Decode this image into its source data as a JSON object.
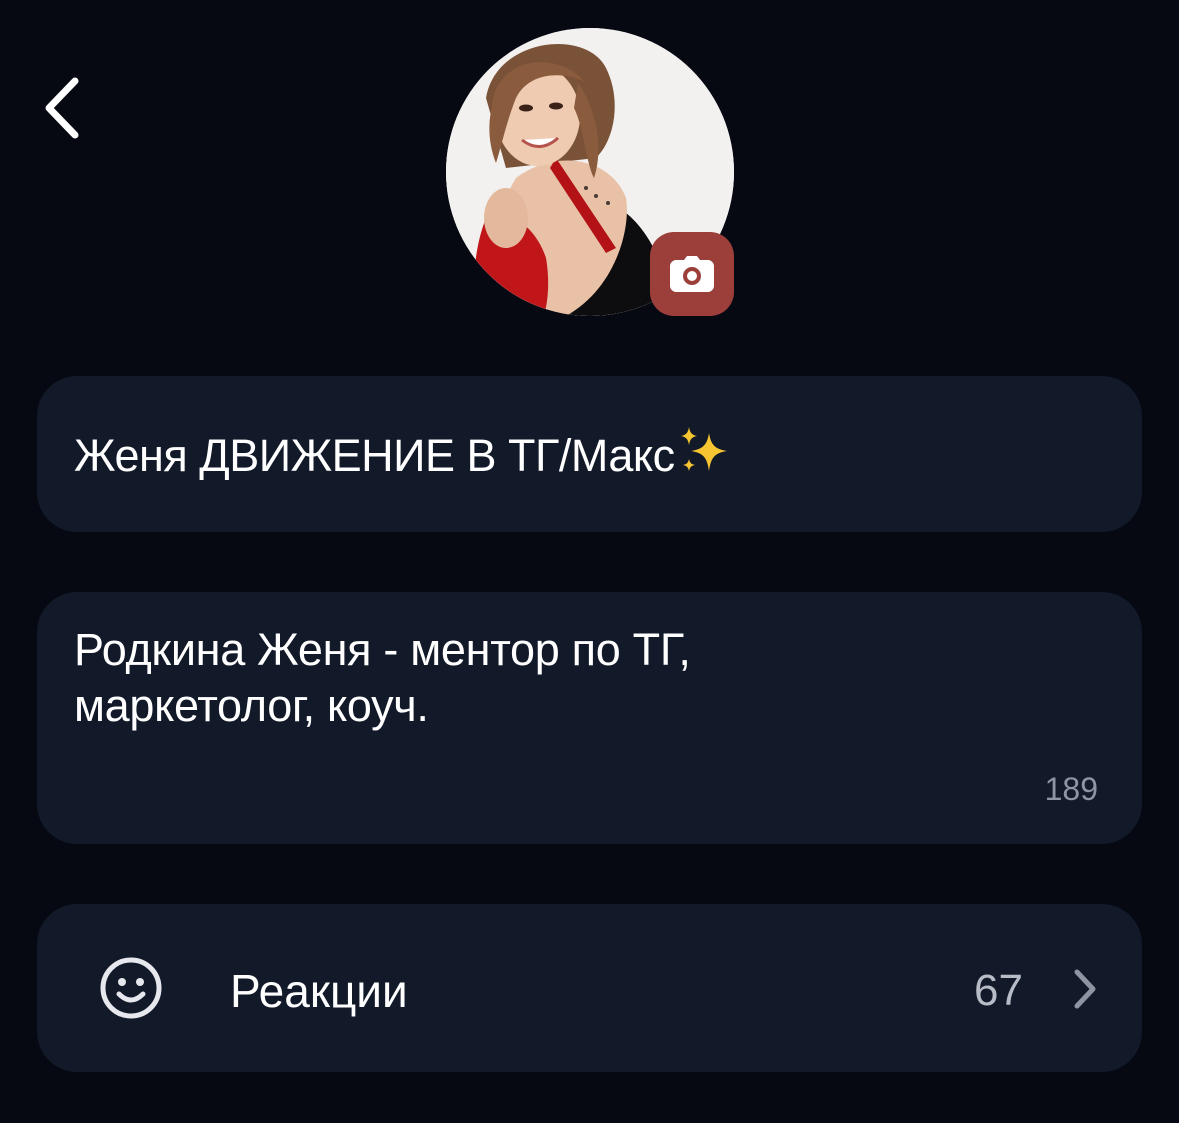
{
  "colors": {
    "background": "#060912",
    "card": "#121929",
    "camera_button": "#9c3f3b",
    "secondary_text": "#8e94a2"
  },
  "header": {
    "back_icon": "chevron-left-icon",
    "avatar_icon": "profile-photo",
    "camera_icon": "camera-icon"
  },
  "profile": {
    "name": "Женя ДВИЖЕНИЕ В ТГ/Макс",
    "name_emoji": "sparkles",
    "bio": "Родкина Женя - ментор по ТГ, маркетолог, коуч.",
    "bio_chars_left": "189"
  },
  "reactions": {
    "icon": "smiley-icon",
    "label": "Реакции",
    "count": "67",
    "chevron_icon": "chevron-right-icon"
  }
}
